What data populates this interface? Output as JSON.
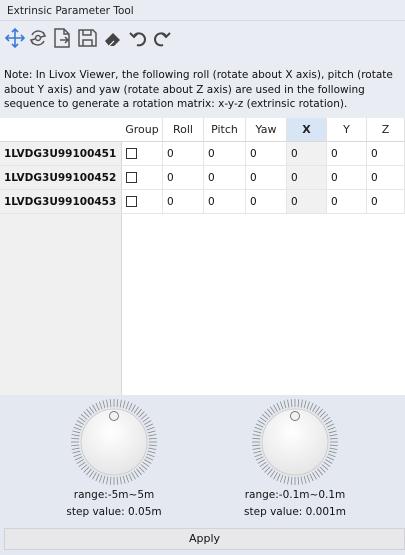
{
  "window": {
    "title": "Extrinsic Parameter Tool"
  },
  "toolbar": {
    "buttons": [
      {
        "icon": "move-arrows-icon",
        "color": "#3a7bd5"
      },
      {
        "icon": "refresh-icon",
        "color": "#555555"
      },
      {
        "icon": "import-file-icon",
        "color": "#555555"
      },
      {
        "icon": "save-icon",
        "color": "#555555"
      },
      {
        "icon": "eraser-icon",
        "color": "#444444"
      },
      {
        "icon": "undo-icon",
        "color": "#444444"
      },
      {
        "icon": "redo-icon",
        "color": "#444444"
      }
    ]
  },
  "note": {
    "lines": [
      "Note: In Livox Viewer, the following roll (rotate about X axis), pitch (rotate",
      "about Y axis) and yaw (rotate about Z axis) are used in the following",
      "sequence to generate a rotation matrix: x-y-z (extrinsic rotation)."
    ]
  },
  "table": {
    "columns": [
      "Group",
      "Roll",
      "Pitch",
      "Yaw",
      "X",
      "Y",
      "Z"
    ],
    "selected_column": "X",
    "rows": [
      {
        "id": "1LVDG3U99100451",
        "group": false,
        "values": [
          "0",
          "0",
          "0",
          "0",
          "0",
          "0"
        ]
      },
      {
        "id": "1LVDG3U99100452",
        "group": false,
        "values": [
          "0",
          "0",
          "0",
          "0",
          "0",
          "0"
        ]
      },
      {
        "id": "1LVDG3U99100453",
        "group": false,
        "values": [
          "0",
          "0",
          "0",
          "0",
          "0",
          "0"
        ]
      }
    ]
  },
  "knobs": [
    {
      "range": "range:-5m~5m",
      "step": "step value: 0.05m"
    },
    {
      "range": "range:-0.1m~0.1m",
      "step": "step value: 0.001m"
    }
  ],
  "apply_label": "Apply"
}
